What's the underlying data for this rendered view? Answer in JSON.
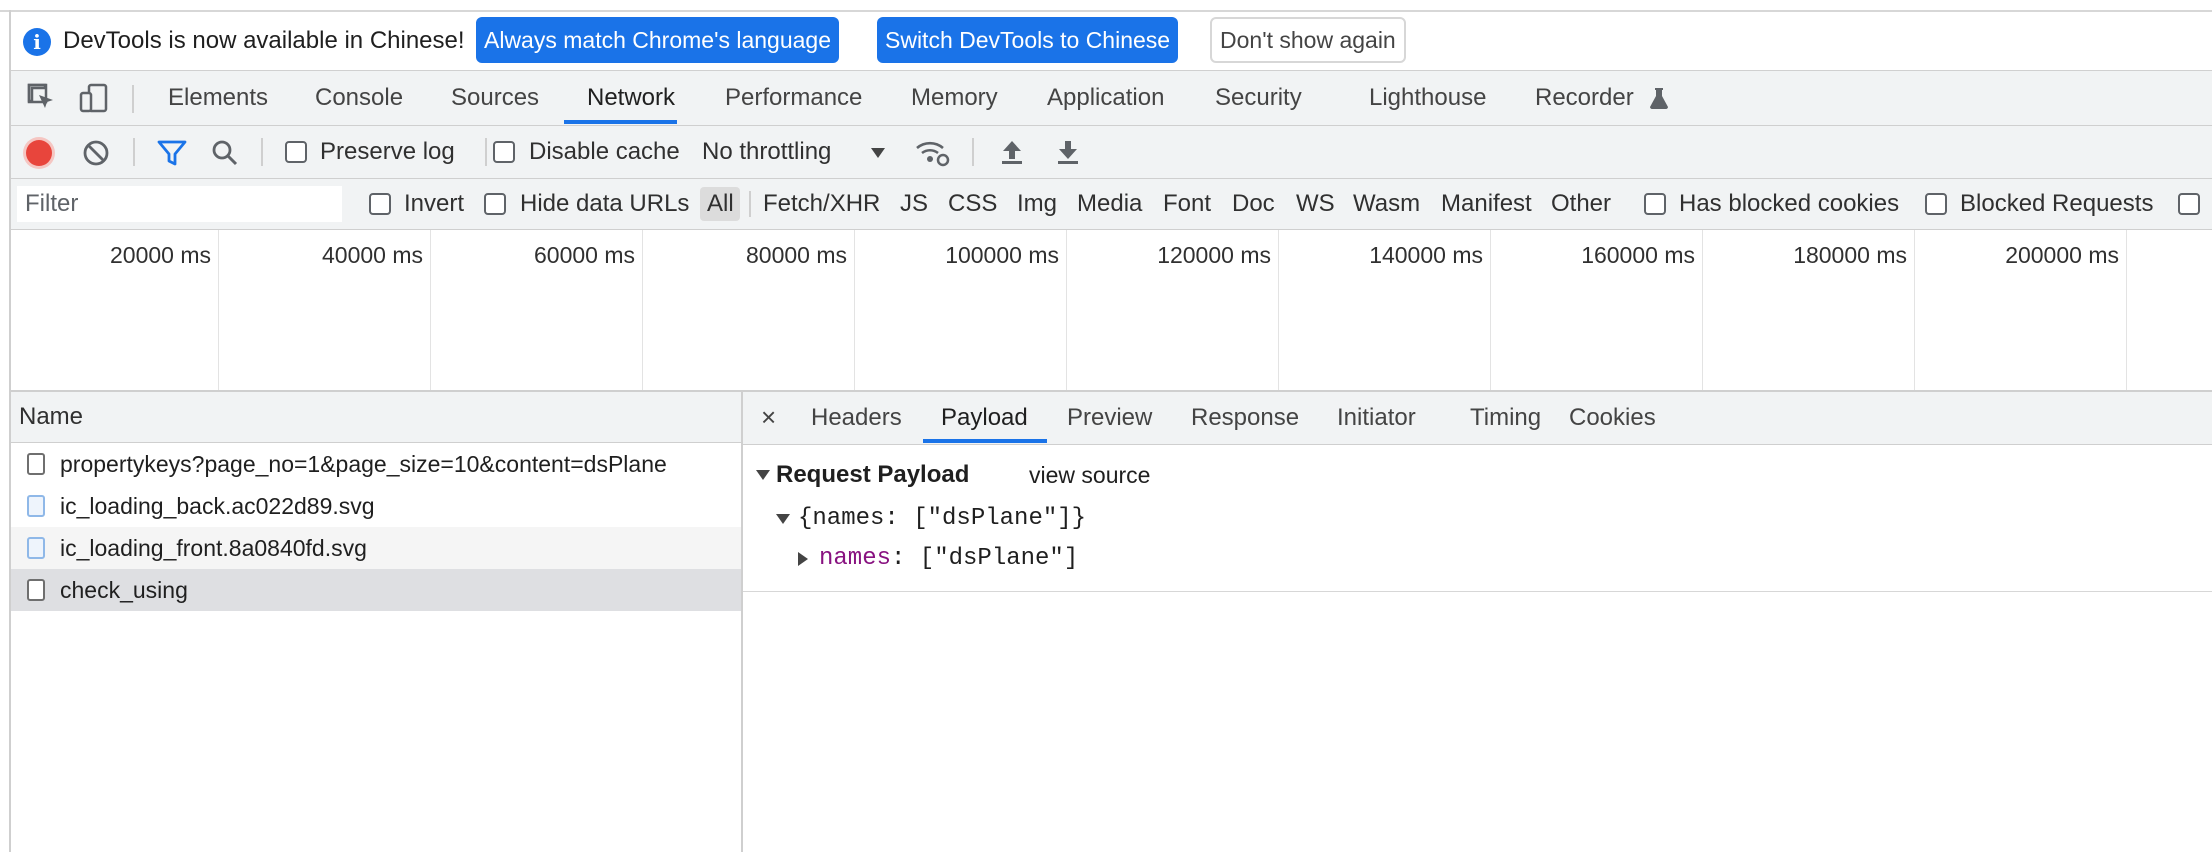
{
  "infobar": {
    "message": "DevTools is now available in Chinese!",
    "btn_match": "Always match Chrome's language",
    "btn_switch": "Switch DevTools to Chinese",
    "btn_dismiss": "Don't show again",
    "accent_color": "#1a73e8"
  },
  "tabs": [
    "Elements",
    "Console",
    "Sources",
    "Network",
    "Performance",
    "Memory",
    "Application",
    "Security",
    "Lighthouse",
    "Recorder"
  ],
  "active_tab": "Network",
  "toolbar": {
    "preserve_log": "Preserve log",
    "disable_cache": "Disable cache",
    "throttling": "No throttling"
  },
  "filterbar": {
    "placeholder": "Filter",
    "invert": "Invert",
    "hide_data_urls": "Hide data URLs",
    "types": [
      "All",
      "Fetch/XHR",
      "JS",
      "CSS",
      "Img",
      "Media",
      "Font",
      "Doc",
      "WS",
      "Wasm",
      "Manifest",
      "Other"
    ],
    "has_blocked_cookies": "Has blocked cookies",
    "blocked_requests": "Blocked Requests"
  },
  "overview": {
    "ticks": [
      "20000 ms",
      "40000 ms",
      "60000 ms",
      "80000 ms",
      "100000 ms",
      "120000 ms",
      "140000 ms",
      "160000 ms",
      "180000 ms",
      "200000 ms"
    ]
  },
  "requests": {
    "header": "Name",
    "rows": [
      "propertykeys?page_no=1&page_size=10&content=dsPlane",
      "ic_loading_back.ac022d89.svg",
      "ic_loading_front.8a0840fd.svg",
      "check_using"
    ],
    "selected_index": 3
  },
  "detail": {
    "close": "×",
    "tabs": [
      "Headers",
      "Payload",
      "Preview",
      "Response",
      "Initiator",
      "Timing",
      "Cookies"
    ],
    "active_tab": "Payload",
    "section_title": "Request Payload",
    "view_source": "view source",
    "object_summary": "{names: [\"dsPlane\"]}",
    "prop_key": "names",
    "prop_value": ": [\"dsPlane\"]"
  }
}
